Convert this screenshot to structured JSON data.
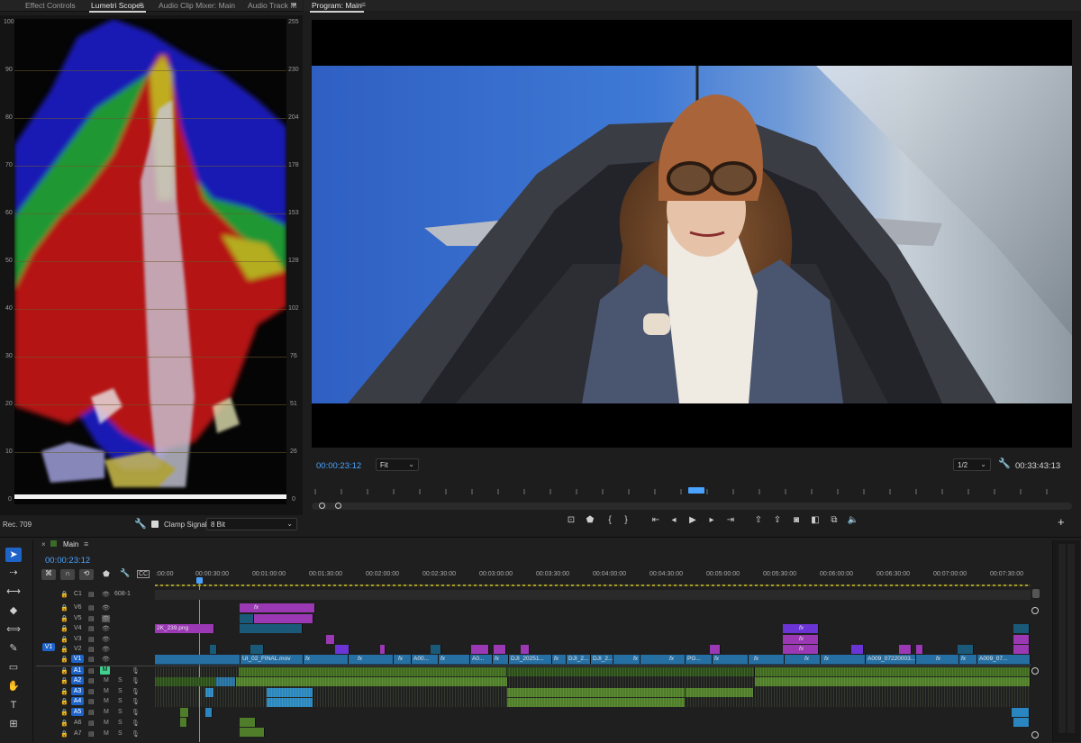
{
  "scopes_panel": {
    "tabs": [
      "Effect Controls",
      "Lumetri Scopes",
      "Audio Clip Mixer: Main",
      "Audio Track M"
    ],
    "active_tab": "Lumetri Scopes",
    "overflow_icon": "double-chevron-right",
    "left_scale": [
      "100",
      "90",
      "80",
      "70",
      "60",
      "50",
      "40",
      "30",
      "20",
      "10",
      "0"
    ],
    "right_scale": [
      "255",
      "230",
      "204",
      "178",
      "153",
      "128",
      "102",
      "76",
      "51",
      "26",
      "0"
    ],
    "color_space": "Rec. 709",
    "clamp_signal_label": "Clamp Signal",
    "clamp_signal_checked": true,
    "bit_depth": "8 Bit"
  },
  "program_monitor": {
    "title": "Program: Main",
    "current_timecode": "00:00:23:12",
    "fit_label": "Fit",
    "resolution": "1/2",
    "duration_timecode": "00:33:43:13",
    "add_button": "+"
  },
  "timeline": {
    "sequence_name": "Main",
    "current_timecode": "00:00:23:12",
    "ruler_labels": [
      ":00:00",
      "00:00:30:00",
      "00:01:00:00",
      "00:01:30:00",
      "00:02:00:00",
      "00:02:30:00",
      "00:03:00:00",
      "00:03:30:00",
      "00:04:00:00",
      "00:04:30:00",
      "00:05:00:00",
      "00:05:30:00",
      "00:06:00:00",
      "00:06:30:00",
      "00:07:00:00",
      "00:07:30:00"
    ],
    "caption_track": {
      "name": "C1",
      "label": "608-1"
    },
    "video_tracks": [
      "V6",
      "V5",
      "V4",
      "V3",
      "V2",
      "V1"
    ],
    "audio_tracks": [
      "A1",
      "A2",
      "A3",
      "A4",
      "A5",
      "A6",
      "A7"
    ],
    "source_patch": "V1",
    "clip_labels": {
      "v4_first": "2K_239.png",
      "v1_ui": "UI_02_FINAL.mov",
      "v1_a00": "A00...",
      "v1_a0": "A0...",
      "v1_dji1": "DJI_20251...",
      "v1_dji2": "DJI_2...",
      "v1_dji3": "DJI_2...",
      "v1_pg": "PG...",
      "v1_a009a": "A009_07220003...",
      "v1_a009b": "A009_07...",
      "fx": "fx"
    },
    "mute_label": "M",
    "solo_label": "S"
  },
  "colors": {
    "accent_blue": "#1e63c8",
    "timecode_blue": "#4aa3ff",
    "video_clip": "#266fa3",
    "pink_clip": "#9b38b4",
    "purple_clip": "#6a35d4",
    "audio_clip": "#4f7d2a"
  }
}
